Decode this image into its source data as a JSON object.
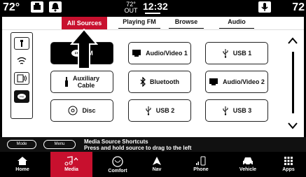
{
  "status": {
    "temp_left": "72°",
    "temp_right": "72",
    "outside_temp": "72°",
    "outside_label": "OUT",
    "clock": "12:32"
  },
  "tabs": [
    {
      "label": "All Sources",
      "active": true
    },
    {
      "label": "Playing FM",
      "active": false
    },
    {
      "label": "Browse",
      "active": false
    },
    {
      "label": "Audio",
      "active": false
    }
  ],
  "sources": [
    {
      "label": "M",
      "icon": "fm-icon",
      "selected": true
    },
    {
      "label": "Audio/Video 1",
      "icon": "monitor-icon"
    },
    {
      "label": "USB 1",
      "icon": "usb-icon"
    },
    {
      "label_line1": "Auxiliary",
      "label_line2": "Cable",
      "icon": "aux-plug-icon"
    },
    {
      "label": "Bluetooth",
      "icon": "bluetooth-icon"
    },
    {
      "label": "Audio/Video 2",
      "icon": "monitor-icon"
    },
    {
      "label": "Disc",
      "icon": "disc-icon"
    },
    {
      "label": "USB 2",
      "icon": "usb-icon"
    },
    {
      "label": "USB 3",
      "icon": "usb-icon"
    }
  ],
  "footer": {
    "mode_label": "Mode",
    "menu_label": "Menu",
    "message_title": "Media Source Shortcuts",
    "message_body": "Press and hold source to drag to the left"
  },
  "nav": [
    {
      "label": "Home",
      "icon": "home-icon"
    },
    {
      "label": "Media",
      "icon": "music-icon",
      "active": true
    },
    {
      "label": "Comfort",
      "icon": "comfort-icon"
    },
    {
      "label": "Nav",
      "icon": "nav-arrow-icon"
    },
    {
      "label": "Phone",
      "icon": "phone-icon"
    },
    {
      "label": "Vehicle",
      "icon": "car-icon"
    },
    {
      "label": "Apps",
      "icon": "apps-grid-icon"
    }
  ],
  "colors": {
    "accent": "#c8102e"
  }
}
